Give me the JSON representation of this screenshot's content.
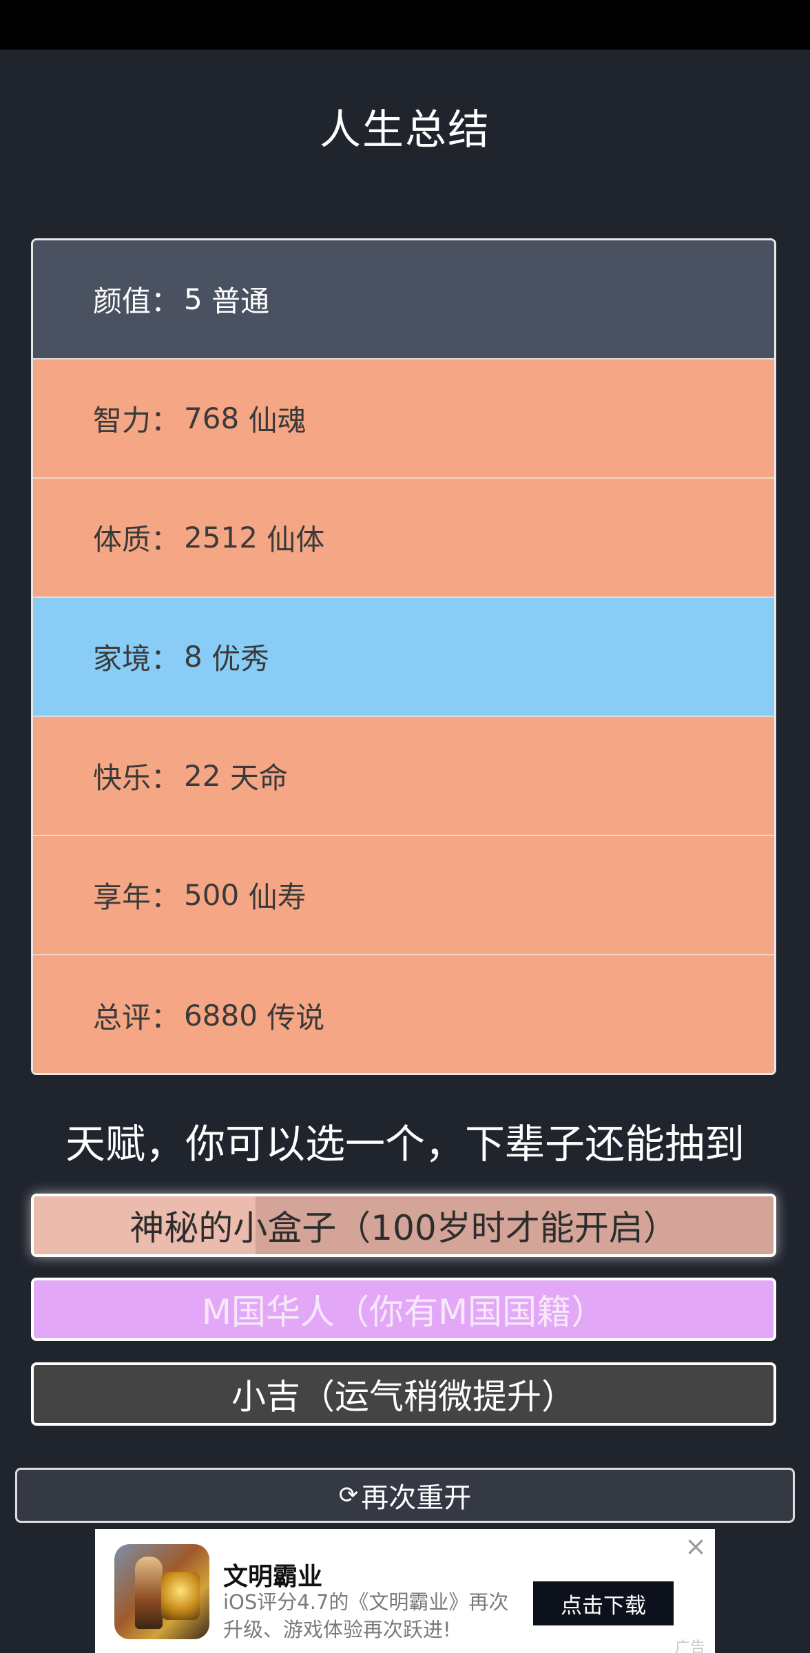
{
  "page_title": "人生总结",
  "summary": [
    {
      "label": "颜值",
      "value": "5",
      "grade": "普通",
      "tone": "normal"
    },
    {
      "label": "智力",
      "value": "768",
      "grade": "仙魂",
      "tone": "gold"
    },
    {
      "label": "体质",
      "value": "2512",
      "grade": "仙体",
      "tone": "gold"
    },
    {
      "label": "家境",
      "value": "8",
      "grade": "优秀",
      "tone": "blue"
    },
    {
      "label": "快乐",
      "value": "22",
      "grade": "天命",
      "tone": "gold"
    },
    {
      "label": "享年",
      "value": "500",
      "grade": "仙寿",
      "tone": "gold"
    },
    {
      "label": "总评",
      "value": "6880",
      "grade": "传说",
      "tone": "gold"
    }
  ],
  "separator": "：",
  "talent_heading": "天赋，你可以选一个，下辈子还能抽到",
  "talents": [
    {
      "label": "神秘的小盒子（100岁时才能开启）"
    },
    {
      "label": "M国华人（你有M国国籍）"
    },
    {
      "label": "小吉（运气稍微提升）"
    }
  ],
  "restart": {
    "icon": "refresh-icon",
    "label": "再次重开"
  },
  "ad": {
    "title": "文明霸业",
    "description": "iOS评分4.7的《文明霸业》再次升级、游戏体验再次跃进!",
    "cta": "点击下载",
    "tag": "广告"
  },
  "colors": {
    "background": "#20242d",
    "normal": "#4a5262",
    "gold": "#f5a684",
    "blue": "#89cdf7",
    "talent_selected": "#d3a497",
    "talent_purple": "#e2a8f7",
    "talent_gray": "#444444"
  }
}
